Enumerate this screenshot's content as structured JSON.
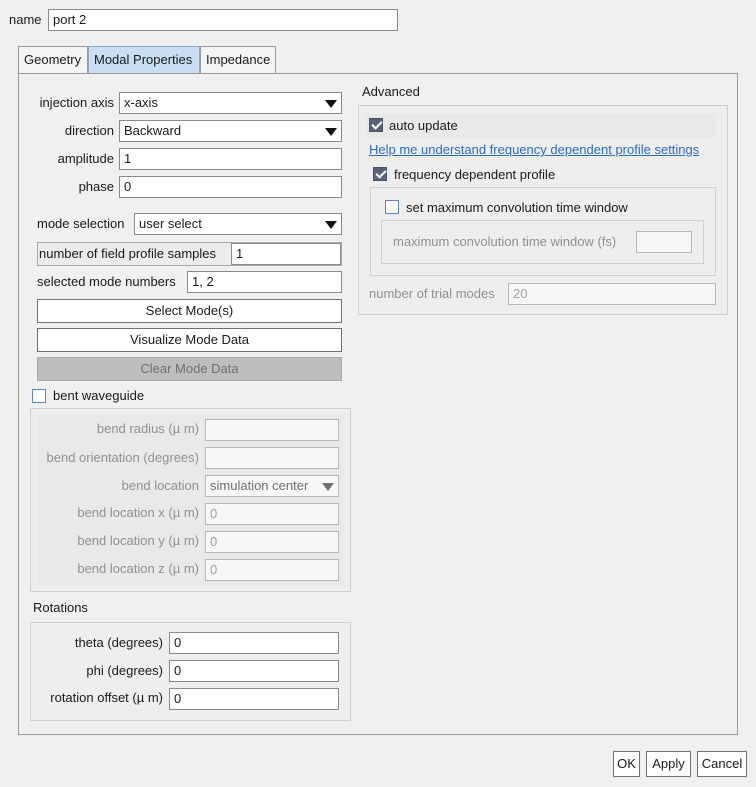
{
  "name_label": "name",
  "name_value": "port 2",
  "tabs": [
    "Geometry",
    "Modal Properties",
    "Impedance"
  ],
  "form": {
    "injection_axis": {
      "label": "injection axis",
      "value": "x-axis"
    },
    "direction": {
      "label": "direction",
      "value": "Backward"
    },
    "amplitude": {
      "label": "amplitude",
      "value": "1"
    },
    "phase": {
      "label": "phase",
      "value": "0"
    },
    "mode_selection": {
      "label": "mode selection",
      "value": "user select"
    },
    "num_profile_samples": {
      "label": "number of field profile samples",
      "value": "1"
    },
    "selected_modes": {
      "label": "selected mode numbers",
      "value": "1, 2"
    },
    "select_modes_btn": "Select Mode(s)",
    "visualize_btn": "Visualize Mode Data",
    "clear_btn": "Clear Mode Data"
  },
  "bent": {
    "label": "bent waveguide",
    "radius_label": "bend radius (µ m)",
    "orientation_label": "bend orientation (degrees)",
    "location_label": "bend location",
    "location_value": "simulation center",
    "loc_x_label": "bend location x (µ m)",
    "loc_x_value": "0",
    "loc_y_label": "bend location y (µ m)",
    "loc_y_value": "0",
    "loc_z_label": "bend location z (µ m)",
    "loc_z_value": "0"
  },
  "rotations": {
    "title": "Rotations",
    "theta_label": "theta (degrees)",
    "theta_value": "0",
    "phi_label": "phi (degrees)",
    "phi_value": "0",
    "offset_label": "rotation offset (µ m)",
    "offset_value": "0"
  },
  "advanced": {
    "title": "Advanced",
    "auto_update": "auto update",
    "help_link": "Help me understand frequency dependent profile settings",
    "freq_dep": "frequency dependent profile",
    "set_max_conv": "set maximum convolution time window",
    "max_conv_label": "maximum convolution time window (fs)",
    "num_trial_label": "number of trial modes",
    "num_trial_value": "20"
  },
  "buttons": {
    "ok": "OK",
    "apply": "Apply",
    "cancel": "Cancel"
  }
}
